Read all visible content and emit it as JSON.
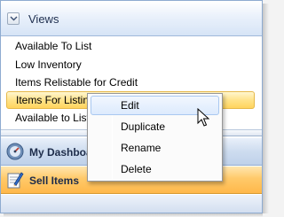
{
  "views_panel": {
    "title": "Views",
    "items": [
      {
        "label": "Available To List"
      },
      {
        "label": "Low Inventory"
      },
      {
        "label": "Items Relistable for Credit"
      },
      {
        "label": "Items For Listing",
        "selected": true
      },
      {
        "label": "Available to List,"
      }
    ]
  },
  "navigation": {
    "dashboard_label": "My Dashboard",
    "sell_label": "Sell Items"
  },
  "context_menu": {
    "items": [
      {
        "label": "Edit",
        "hover": true
      },
      {
        "label": "Duplicate"
      },
      {
        "label": "Rename"
      },
      {
        "label": "Delete"
      }
    ]
  },
  "colors": {
    "selection": "#ffd45e",
    "sell_active": "#ffb84a",
    "header": "#d6e4f6"
  }
}
